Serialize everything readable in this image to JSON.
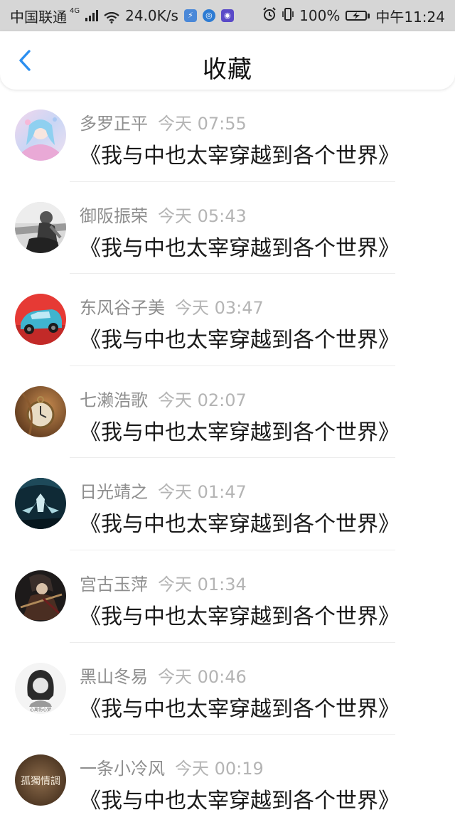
{
  "status_bar": {
    "carrier": "中国联通",
    "network": "4G",
    "speed": "24.0K/s",
    "battery": "100%",
    "time": "中午11:24",
    "icons": [
      "signal-icon",
      "wifi-icon",
      "power-saver-icon",
      "globe-app-icon",
      "app-notification-icon",
      "alarm-icon",
      "vibrate-icon",
      "battery-icon"
    ]
  },
  "header": {
    "title": "收藏",
    "back_icon": "chevron-left-icon",
    "accent_color": "#2b8ff0"
  },
  "items": [
    {
      "user": "多罗正平",
      "time": "今天 07:55",
      "title": "《我与中也太宰穿越到各个世界》",
      "avatar": "anime-girl"
    },
    {
      "user": "御阪振荣",
      "time": "今天 05:43",
      "title": "《我与中也太宰穿越到各个世界》",
      "avatar": "bw-woman"
    },
    {
      "user": "东风谷子美",
      "time": "今天 03:47",
      "title": "《我与中也太宰穿越到各个世界》",
      "avatar": "toy-car"
    },
    {
      "user": "七濑浩歌",
      "time": "今天 02:07",
      "title": "《我与中也太宰穿越到各个世界》",
      "avatar": "pocket-watch"
    },
    {
      "user": "日光靖之",
      "time": "今天 01:47",
      "title": "《我与中也太宰穿越到各个世界》",
      "avatar": "dark-creature"
    },
    {
      "user": "宫古玉萍",
      "time": "今天 01:34",
      "title": "《我与中也太宰穿越到各个世界》",
      "avatar": "anime-warrior"
    },
    {
      "user": "黑山冬易",
      "time": "今天 00:46",
      "title": "《我与中也太宰穿越到各个世界》",
      "avatar": "bw-girl-caption",
      "avatar_caption": "心离伤心梦"
    },
    {
      "user": "一条小冷风",
      "time": "今天 00:19",
      "title": "《我与中也太宰穿越到各个世界》",
      "avatar": "text-tile",
      "avatar_caption": "孤獨情調"
    }
  ]
}
